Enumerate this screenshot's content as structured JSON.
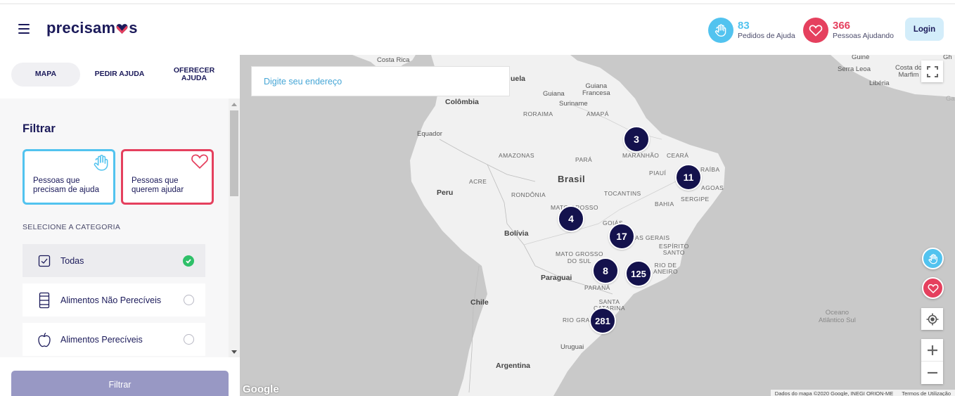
{
  "header": {
    "logo_text_left": "precisam",
    "logo_text_right": "s",
    "stats": [
      {
        "value": "83",
        "label": "Pedidos de Ajuda",
        "color": "#52c3ef",
        "icon": "hand-icon"
      },
      {
        "value": "366",
        "label": "Pessoas Ajudando",
        "color": "#e5405e",
        "icon": "heart-icon"
      }
    ],
    "login_label": "Login"
  },
  "sidebar": {
    "tabs": [
      {
        "label": "MAPA",
        "active": true
      },
      {
        "label": "PEDIR AJUDA",
        "active": false
      },
      {
        "label": "OFERECER AJUDA",
        "active": false
      }
    ],
    "filter_title": "Filtrar",
    "filter_cards": [
      {
        "label": "Pessoas que precisam de ajuda",
        "color": "#52c3ef",
        "icon": "hand-icon"
      },
      {
        "label": "Pessoas que querem ajudar",
        "color": "#e5405e",
        "icon": "heart-icon"
      }
    ],
    "category_label": "SELECIONE A CATEGORIA",
    "categories": [
      {
        "label": "Todas",
        "icon": "checkbox-icon",
        "selected": true
      },
      {
        "label": "Alimentos Não Perecíveis",
        "icon": "can-icon",
        "selected": false
      },
      {
        "label": "Alimentos Perecíveis",
        "icon": "apple-icon",
        "selected": false
      }
    ],
    "filter_button": "Filtrar"
  },
  "map": {
    "search_placeholder": "Digite seu endereço",
    "labels": {
      "costa_rica": "Costa Rica",
      "venezuela": "uela",
      "colombia": "Colômbia",
      "guiana": "Guiana",
      "guiana_francesa": "Guiana\nFrancesa",
      "suriname": "Suriname",
      "roraima": "RORAIMA",
      "amapa": "AMAPÁ",
      "equador": "Equador",
      "amazonas": "AMAZONAS",
      "para": "PARÁ",
      "maranhao": "MARANHÃO",
      "ceara": "CEARÁ",
      "paraiba": "RAÍBA",
      "piaui": "PIAUÍ",
      "alagoas": "AGOAS",
      "brasil": "Brasil",
      "acre": "ACRE",
      "peru": "Peru",
      "rondonia": "RONDÔNIA",
      "tocantins": "TOCANTINS",
      "sergipe": "SERGIPE",
      "bahia": "BAHIA",
      "mato_grosso": "MATO GROSSO",
      "goias": "GOIÁS",
      "minas": "AS GERAIS",
      "bolivia": "Bolívia",
      "espirito_santo": "ESPÍRITO\nSANTO",
      "mato_grosso_sul": "MATO GROSSO\nDO SUL",
      "rio": "RIO DE\nANEIRO",
      "paraguai": "Paraguai",
      "parana": "PARANÁ",
      "chile": "Chile",
      "santa_catarina": "SANTA\nCATARINA",
      "rio_grande": "RIO GRA",
      "uruguai": "Uruguai",
      "argentina": "Argentina",
      "guine": "Guiné",
      "serra_leoa": "Serra Leoa",
      "costa_marfim": "Costa do\nMarfim",
      "liberia": "Libéria",
      "oceano": "Oceano\nAtlântico Sul",
      "gha": "Gh",
      "gab": "Ga"
    },
    "clusters": [
      "3",
      "11",
      "4",
      "17",
      "8",
      "125",
      "281"
    ],
    "google_logo": "Google",
    "attribution": "Dados do mapa ©2020 Google, INEGI ORION-ME",
    "terms": "Termos de Utilização",
    "colors": {
      "land": "#f1f1f1",
      "water": "#c9c9c9",
      "cluster": "#14124d"
    }
  }
}
